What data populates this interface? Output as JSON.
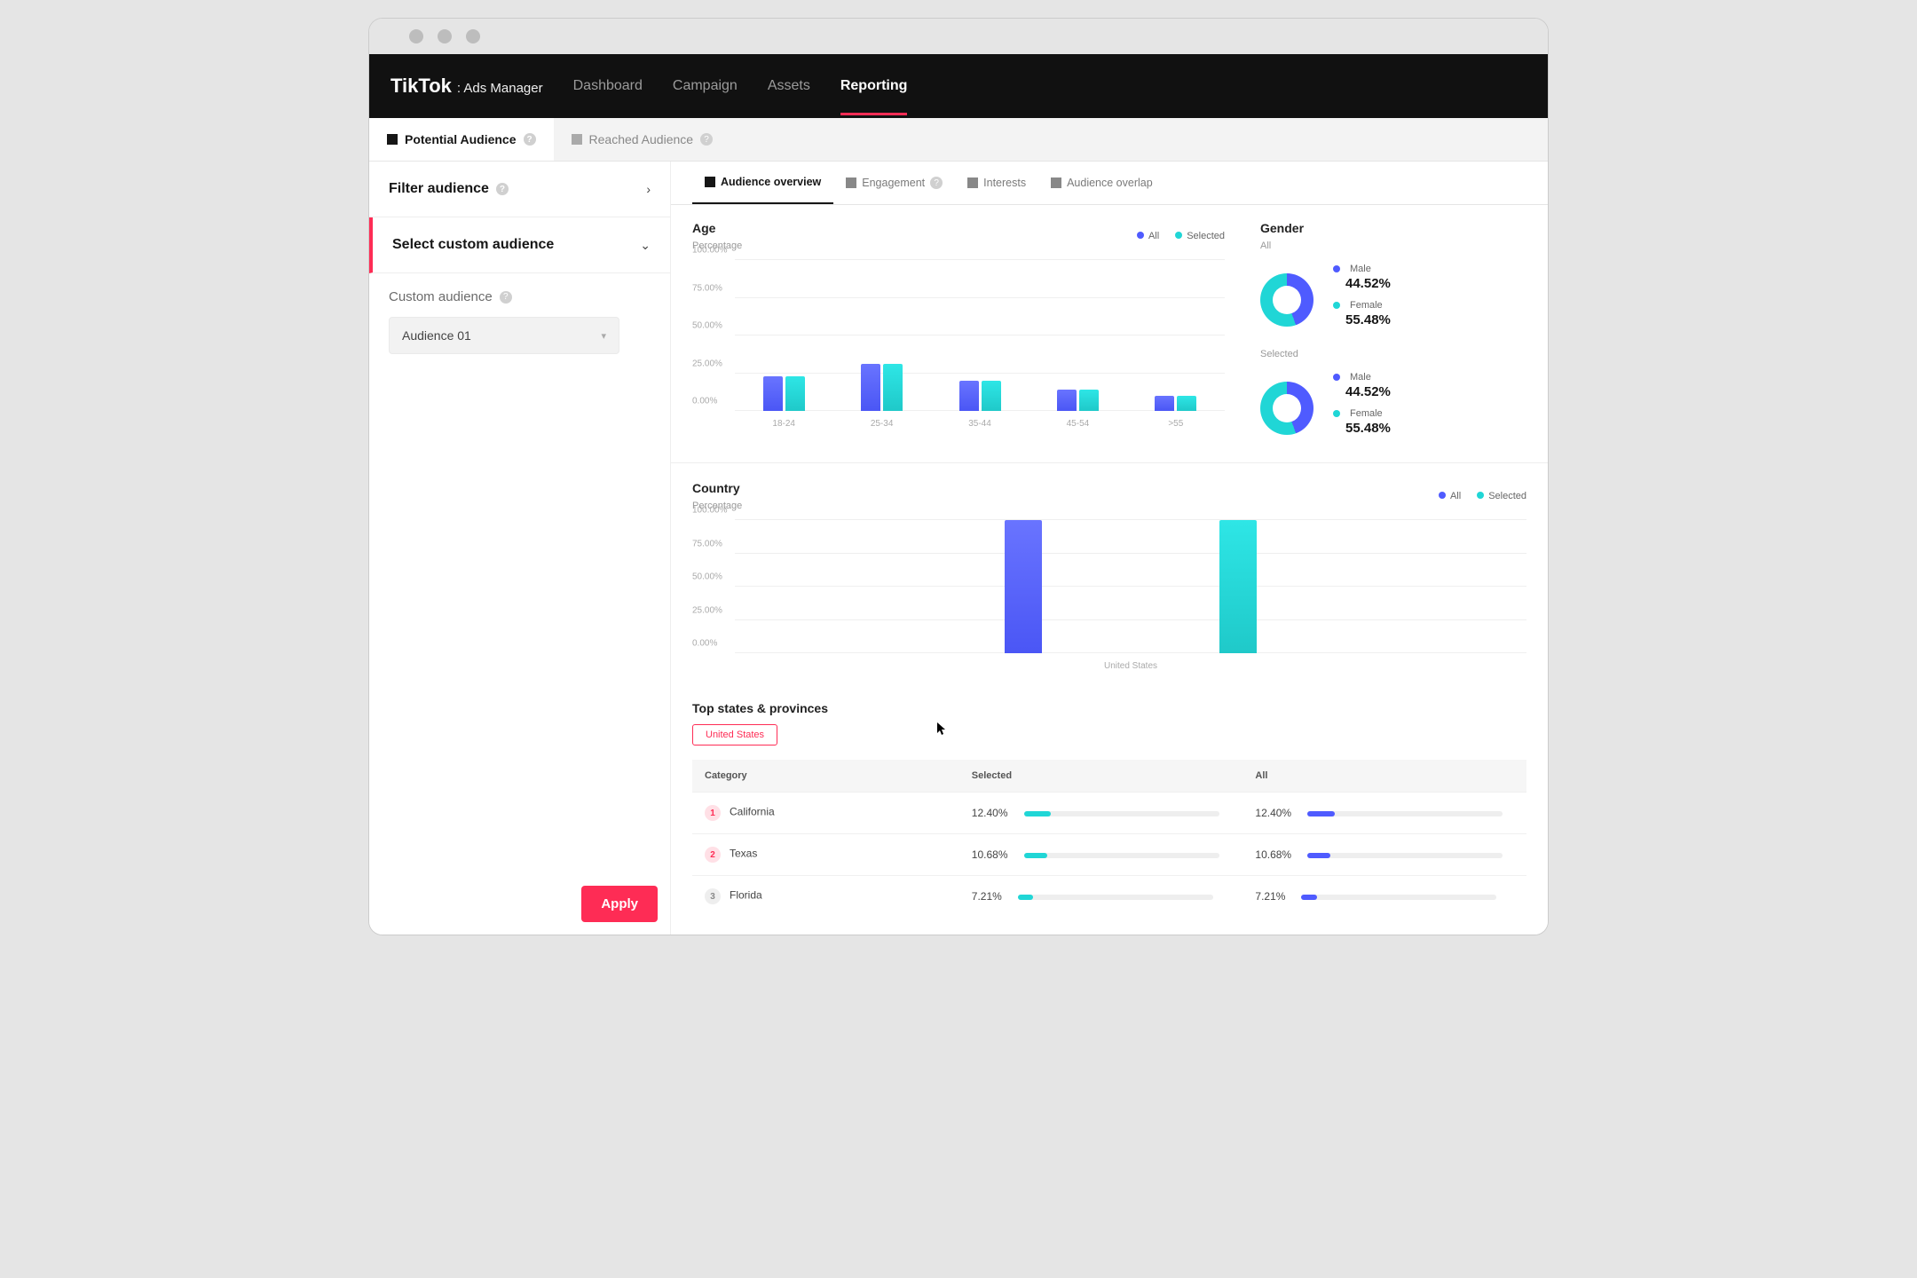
{
  "brand": {
    "name": "TikTok",
    "suffix": ": Ads Manager"
  },
  "nav": {
    "dashboard": "Dashboard",
    "campaign": "Campaign",
    "assets": "Assets",
    "reporting": "Reporting"
  },
  "subtabs": {
    "potential": "Potential Audience",
    "reached": "Reached Audience"
  },
  "sidebar": {
    "filter": "Filter audience",
    "select_custom": "Select custom audience",
    "custom_label": "Custom audience",
    "audience_value": "Audience 01",
    "apply": "Apply"
  },
  "mtabs": {
    "overview": "Audience overview",
    "engagement": "Engagement",
    "interests": "Interests",
    "overlap": "Audience overlap"
  },
  "legend": {
    "all": "All",
    "selected": "Selected"
  },
  "age": {
    "title": "Age",
    "sub": "Percentage"
  },
  "gender": {
    "title": "Gender",
    "all_label": "All",
    "selected_label": "Selected",
    "male": "Male",
    "female": "Female",
    "all_male": "44.52%",
    "all_female": "55.48%",
    "sel_male": "44.52%",
    "sel_female": "55.48%"
  },
  "country": {
    "title": "Country",
    "sub": "Percentage",
    "xlabel": "United States"
  },
  "states": {
    "title": "Top states & provinces",
    "chip": "United States",
    "cols": {
      "category": "Category",
      "selected": "Selected",
      "all": "All"
    },
    "rows": [
      {
        "rank": "1",
        "name": "California",
        "sel": "12.40%",
        "all": "12.40%",
        "selw": 14,
        "allw": 14
      },
      {
        "rank": "2",
        "name": "Texas",
        "sel": "10.68%",
        "all": "10.68%",
        "selw": 12,
        "allw": 12
      },
      {
        "rank": "3",
        "name": "Florida",
        "sel": "7.21%",
        "all": "7.21%",
        "selw": 8,
        "allw": 8
      }
    ]
  },
  "chart_data": [
    {
      "type": "bar",
      "title": "Age",
      "ylabel": "Percentage",
      "ylim": [
        0,
        100
      ],
      "yticks": [
        "0.00%",
        "25.00%",
        "50.00%",
        "75.00%",
        "100.00%"
      ],
      "categories": [
        "18-24",
        "25-34",
        "35-44",
        "45-54",
        ">55"
      ],
      "series": [
        {
          "name": "All",
          "values": [
            23,
            31,
            20,
            14,
            10
          ]
        },
        {
          "name": "Selected",
          "values": [
            23,
            31,
            20,
            14,
            10
          ]
        }
      ]
    },
    {
      "type": "pie",
      "title": "Gender — All",
      "categories": [
        "Male",
        "Female"
      ],
      "values": [
        44.52,
        55.48
      ]
    },
    {
      "type": "pie",
      "title": "Gender — Selected",
      "categories": [
        "Male",
        "Female"
      ],
      "values": [
        44.52,
        55.48
      ]
    },
    {
      "type": "bar",
      "title": "Country",
      "ylabel": "Percentage",
      "ylim": [
        0,
        100
      ],
      "yticks": [
        "0.00%",
        "25.00%",
        "50.00%",
        "75.00%",
        "100.00%"
      ],
      "categories": [
        "United States"
      ],
      "series": [
        {
          "name": "All",
          "values": [
            100
          ]
        },
        {
          "name": "Selected",
          "values": [
            100
          ]
        }
      ]
    }
  ]
}
